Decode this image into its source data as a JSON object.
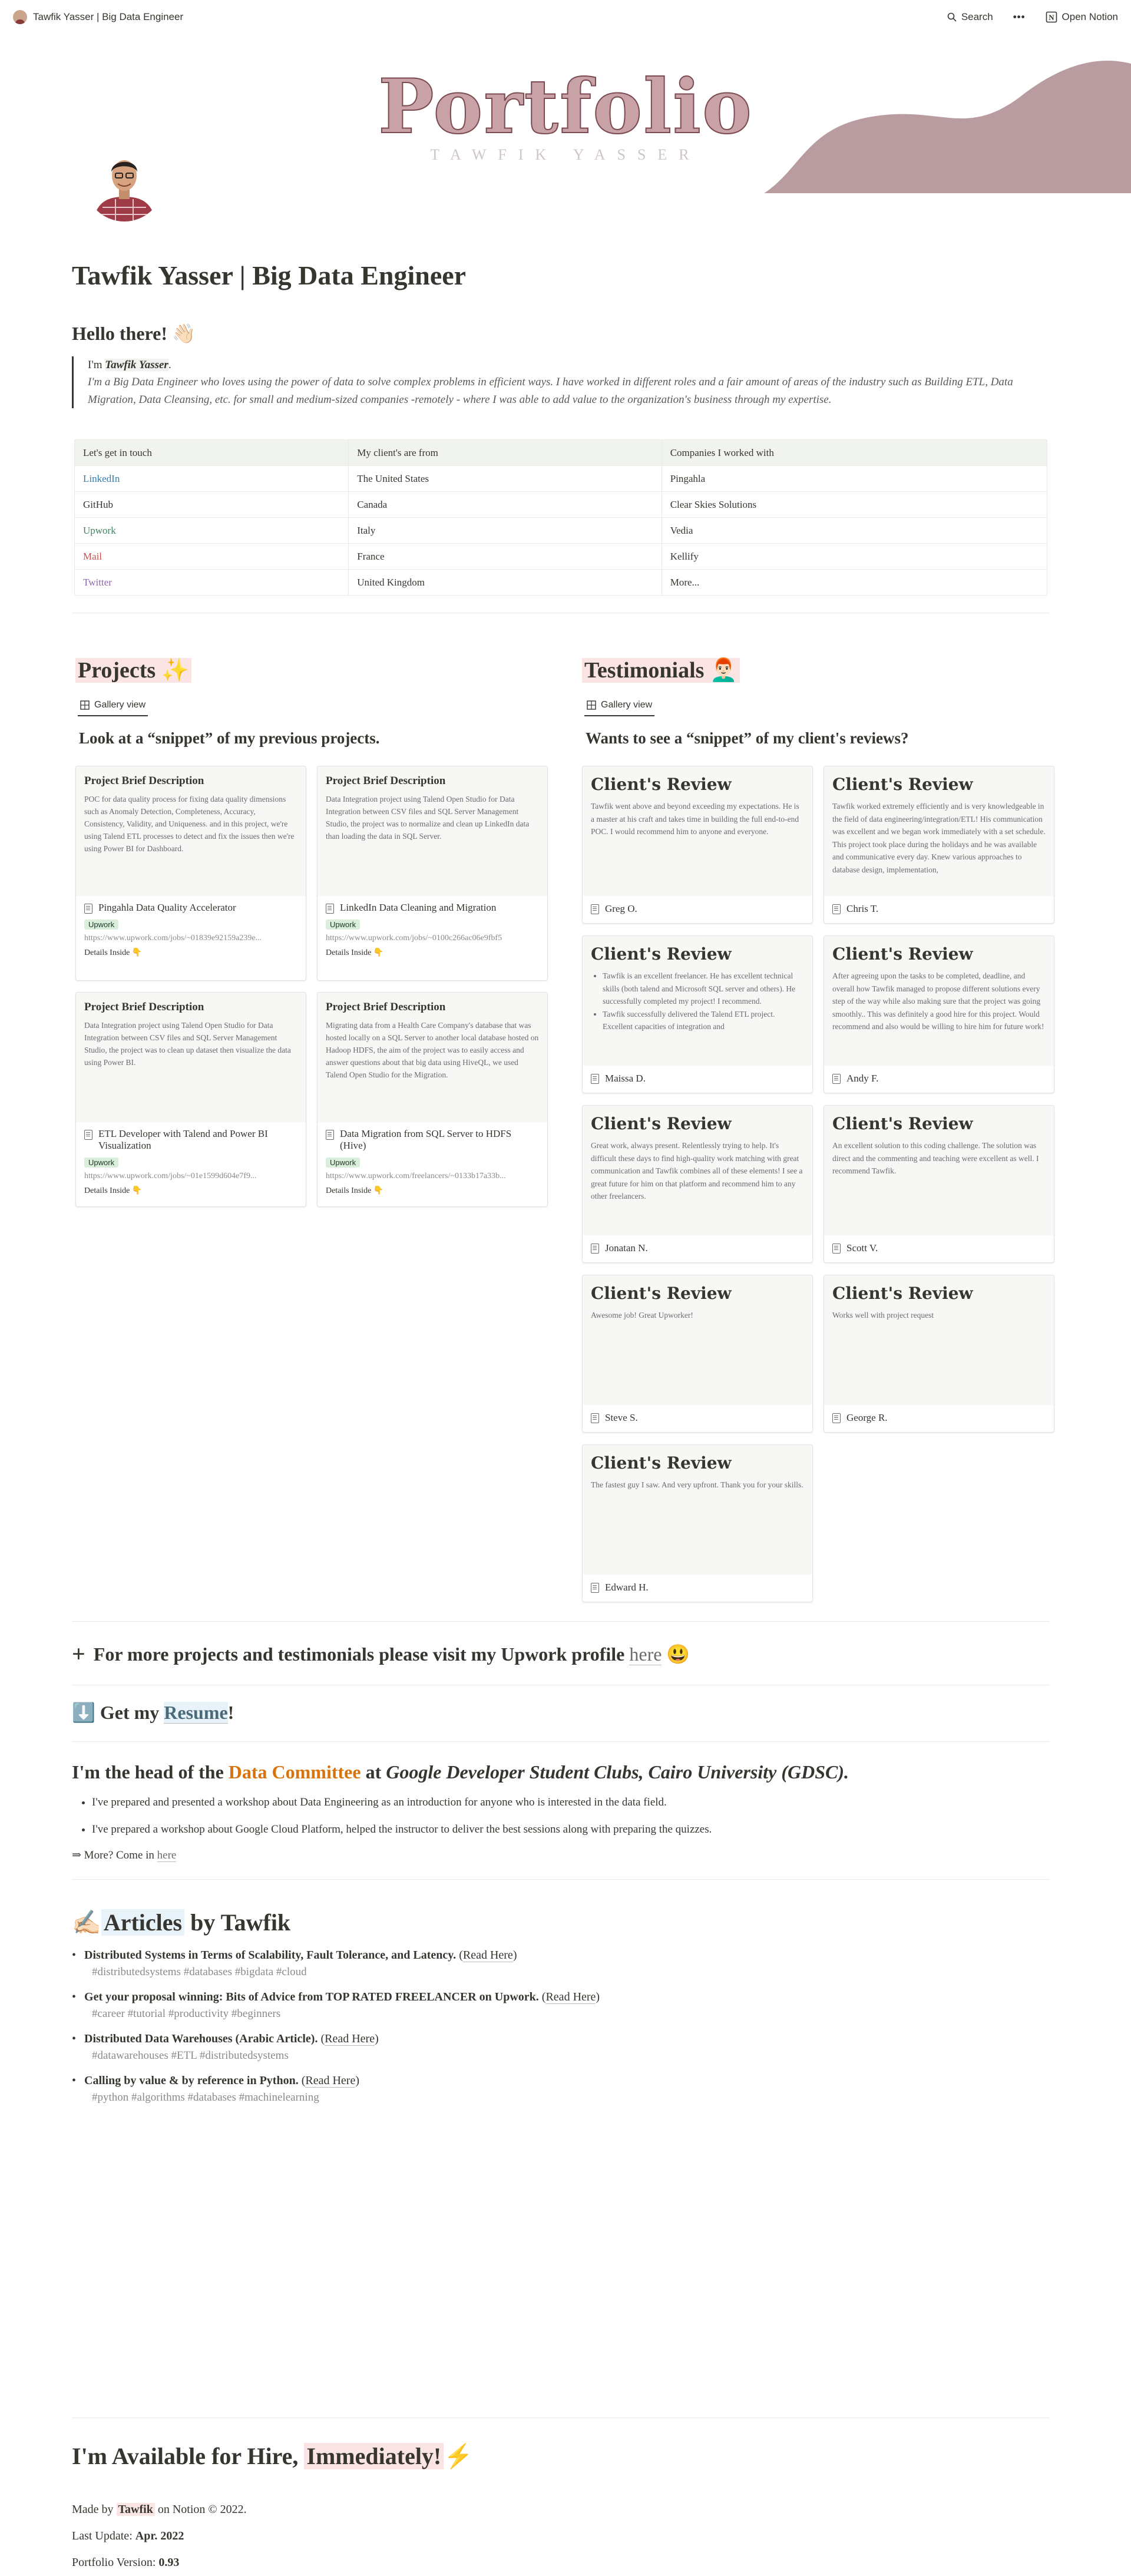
{
  "topbar": {
    "breadcrumb": "Tawfik Yasser | Big Data Engineer",
    "search": "Search",
    "more": "•••",
    "open_notion": "Open Notion"
  },
  "cover": {
    "title": "Portfolio",
    "subtitle": "TAWFIK YASSER"
  },
  "page_title": "Tawfik Yasser | Big Data Engineer",
  "hello": {
    "heading": "Hello there! 👋🏻",
    "im": "I'm ",
    "name": "Tawfik Yasser",
    "bio": "I'm a Big Data Engineer who loves using the power of data to solve complex problems in efficient ways. I have worked in different roles and a fair amount of areas of the industry such as Building ETL, Data Migration, Data Cleansing, etc. for small and medium-sized companies -remotely - where I was able to add value to the organization's business through my expertise."
  },
  "links_table": {
    "headers": [
      "Let's get in touch",
      "My client's are from",
      "Companies I worked with"
    ],
    "rows": [
      [
        "LinkedIn",
        "The United States",
        "Pingahla"
      ],
      [
        "GitHub",
        "Canada",
        "Clear Skies Solutions"
      ],
      [
        "Upwork",
        "Italy",
        "Vedia"
      ],
      [
        "Mail",
        "France",
        "Kellify"
      ],
      [
        "Twitter",
        "United Kingdom",
        "More..."
      ]
    ],
    "link_colors": [
      "#337ea9",
      "#37352f",
      "#448361",
      "#d44c47",
      "#9065b0"
    ]
  },
  "projects": {
    "heading": "Projects ✨",
    "view": "Gallery view",
    "subheading": "Look at a “snippet” of my previous projects.",
    "cards": [
      {
        "ptitle": "Project Brief Description",
        "ptext": "POC for data quality process for fixing data quality dimensions such as Anomaly Detection, Completeness, Accuracy, Consistency, Validity, and Uniqueness. and in this project, we're using Talend ETL processes to detect and fix the issues then we're using Power BI for Dashboard.",
        "name": "Pingahla Data Quality Accelerator",
        "tag": "Upwork",
        "url": "https://www.upwork.com/jobs/~01839e92159a239e...",
        "details": "Details Inside 👇"
      },
      {
        "ptitle": "Project Brief Description",
        "ptext": "Data Integration project using Talend Open Studio for Data Integration between CSV files and SQL Server Management Studio, the project was to normalize and clean up LinkedIn data than loading the data in SQL Server.",
        "name": "LinkedIn Data Cleaning and Migration",
        "tag": "Upwork",
        "url": "https://www.upwork.com/jobs/~0100c266ac06e9fbf5",
        "details": "Details Inside 👇"
      },
      {
        "ptitle": "Project Brief Description",
        "ptext": "Data Integration project using Talend Open Studio for Data Integration between CSV files and SQL Server Management Studio, the project was to clean up dataset then visualize the data using Power BI.",
        "name": "ETL Developer with Talend and Power BI Visualization",
        "tag": "Upwork",
        "url": "https://www.upwork.com/jobs/~01e1599d604e7f9...",
        "details": "Details Inside 👇"
      },
      {
        "ptitle": "Project Brief Description",
        "ptext": "Migrating data from a Health Care Company's database that was hosted locally on a SQL Server to another local database hosted on Hadoop HDFS, the aim of the project was to easily access and answer questions about that big data using HiveQL, we used Talend Open Studio for the Migration.",
        "name": "Data Migration from SQL Server to HDFS (Hive)",
        "tag": "Upwork",
        "url": "https://www.upwork.com/freelancers/~0133b17a33b...",
        "details": "Details Inside 👇"
      }
    ]
  },
  "testimonials": {
    "heading": "Testimonials 👨🏻‍🦰",
    "view": "Gallery view",
    "subheading": "Wants to see a “snippet” of my client's reviews?",
    "cards": [
      {
        "title": "Client's Review",
        "text": "Tawfik went above and beyond exceeding my expectations. He is a master at his craft and takes time in building the full end-to-end POC. I would recommend him to anyone and everyone.",
        "name": "Greg O."
      },
      {
        "title": "Client's Review",
        "text": "Tawfik worked extremely efficiently and is very knowledgeable in the field of data engineering/integration/ETL! His communication was excellent and we began work immediately with a set schedule. This project took place during the holidays and he was available and communicative every day. Knew various approaches to database design, implementation,",
        "name": "Chris T."
      },
      {
        "title": "Client's Review",
        "bullets": [
          "Tawfik is an excellent freelancer. He has excellent technical skills (both talend and Microsoft SQL server and others). He successfully completed my project! I recommend.",
          "Tawfik successfully delivered the Talend ETL project. Excellent capacities of integration and"
        ],
        "name": "Maissa D."
      },
      {
        "title": "Client's Review",
        "text": "After agreeing upon the tasks to be completed, deadline, and overall how Tawfik managed to propose different solutions every step of the way while also making sure that the project was going smoothly.. This was definitely a good hire for this project. Would recommend and also would be willing to hire him for future work!",
        "name": "Andy F."
      },
      {
        "title": "Client's Review",
        "text": "Great work, always present. Relentlessly trying to help. It's difficult these days to find high-quality work matching with great communication and Tawfik combines all of these elements! I see a great future for him on that platform and recommend him to any other freelancers.",
        "name": "Jonatan N."
      },
      {
        "title": "Client's Review",
        "text": "An excellent solution to this coding challenge. The solution was direct and the commenting and teaching were excellent as well. I recommend Tawfik.",
        "name": "Scott V."
      },
      {
        "title": "Client's Review",
        "text": "Awesome job! Great Upworker!",
        "name": "Steve S."
      },
      {
        "title": "Client's Review",
        "text": "Works well with project request",
        "name": "George R."
      },
      {
        "title": "Client's Review",
        "text": "The fastest guy I saw. And very upfront. Thank you for your skills.",
        "name": "Edward H."
      }
    ]
  },
  "more_projects": {
    "text": "For more projects and testimonials please visit my Upwork profile ",
    "link": "here",
    "emoji": "😃"
  },
  "resume": {
    "icon": "⬇️",
    "pre": "Get my ",
    "link": "Resume",
    "post": "!"
  },
  "gdsc": {
    "pre": "I'm the head of the ",
    "committee": "Data Committee",
    "mid": " at ",
    "org": "Google Developer Student Clubs, Cairo University (GDSC).",
    "bullets": [
      "I've prepared and presented a workshop about Data Engineering as an introduction for anyone who is interested in the data field.",
      "I've prepared a workshop about Google Cloud Platform, helped the instructor to deliver the best sessions along with preparing the quizzes."
    ],
    "more_pre": "⇒ More? Come in ",
    "more_link": "here"
  },
  "articles": {
    "icon": "✍🏻",
    "title_hl": "Articles",
    "title_rest": " by Tawfik",
    "items": [
      {
        "title": "Distributed Systems in Terms of Scalability, Fault Tolerance, and Latency.",
        "read": "Read Here",
        "tags": "#distributedsystems #databases #bigdata #cloud"
      },
      {
        "title": "Get your proposal winning: Bits of Advice from TOP RATED FREELANCER on Upwork.",
        "read": "Read Here",
        "tags": "#career #tutorial #productivity #beginners"
      },
      {
        "title": "Distributed Data Warehouses (Arabic Article).",
        "read": "Read Here",
        "tags": "#datawarehouses #ETL #distributedsystems"
      },
      {
        "title": "Calling by value & by reference in Python.",
        "read": "Read Here",
        "tags": "#python #algorithms #databases #machinelearning"
      }
    ]
  },
  "hire": {
    "pre": "I'm Available for Hire, ",
    "hl": "Immediately!",
    "emoji": "⚡"
  },
  "footer": {
    "made_pre": "Made by ",
    "made_name": "Tawfik",
    "made_post": " on Notion © 2022.",
    "update_label": "Last Update: ",
    "update_value": "Apr. 2022",
    "version_label": "Portfolio Version: ",
    "version_value": "0.93"
  },
  "colors": {
    "cover_wave": "#b89ca0",
    "cover_title": "#c8a2a6",
    "upwork_tag": "#dbeddb",
    "committee": "#d9730d",
    "hl_red": "#fbe4e4",
    "hl_blue": "#e7f3f8"
  }
}
